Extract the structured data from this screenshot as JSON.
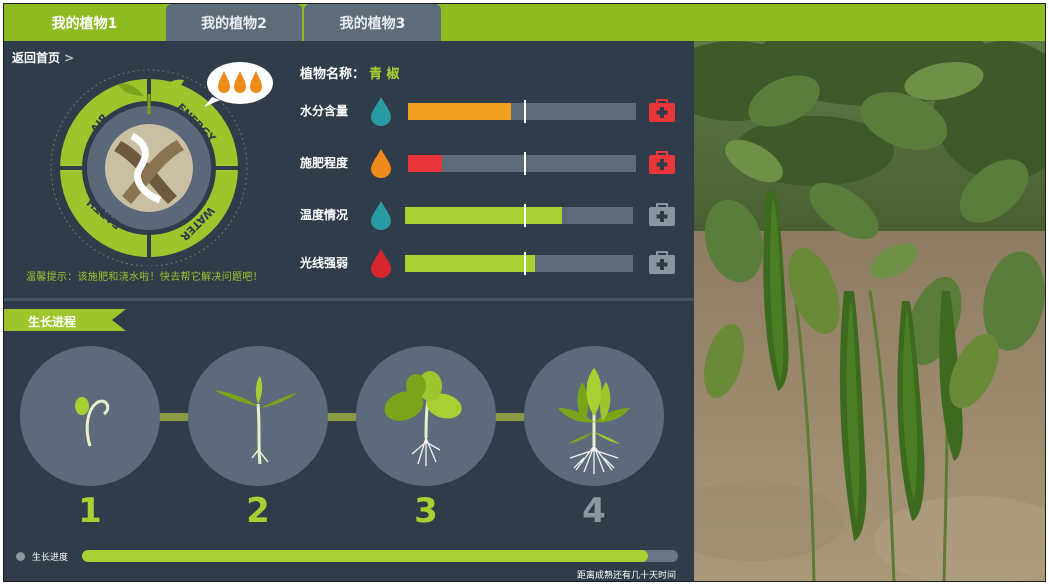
{
  "tabs": [
    {
      "label": "我的植物1",
      "active": true
    },
    {
      "label": "我的植物2",
      "active": false
    },
    {
      "label": "我的植物3",
      "active": false
    }
  ],
  "back_link": {
    "label": "返回首页",
    "chevron": ">"
  },
  "emblem": {
    "labels": [
      "AIR",
      "ENERGY",
      "EARTH",
      "WATER"
    ],
    "colors": {
      "ring": "#9fc52c",
      "inner": "#596778",
      "core": "#c9c0a4",
      "accent": "#6d5a3e"
    }
  },
  "alert_text": "温馨提示：该施肥和浇水啦！快去帮它解决问题吧！",
  "plant": {
    "name_label": "植物名称：",
    "name_value": "青 椒"
  },
  "metrics": [
    {
      "label": "水分含量",
      "drop_color": "#2a9aa3",
      "fill_color": "#f2a01f",
      "value": 0.45,
      "mark": 0.51,
      "kit_color": "#e8363b",
      "kit_active": true
    },
    {
      "label": "施肥程度",
      "drop_color": "#f08a1a",
      "fill_color": "#e8363b",
      "value": 0.15,
      "mark": 0.51,
      "kit_color": "#e8363b",
      "kit_active": true
    },
    {
      "label": "温度情况",
      "drop_color": "#2a9aa3",
      "fill_color": "#a9d033",
      "value": 0.69,
      "mark": 0.52,
      "kit_color": "#8a95a3",
      "kit_active": false
    },
    {
      "label": "光线强弱",
      "drop_color": "#d8262e",
      "fill_color": "#a9d033",
      "value": 0.57,
      "mark": 0.52,
      "kit_color": "#8a95a3",
      "kit_active": false
    }
  ],
  "growth": {
    "title": "生长进程",
    "stages": [
      {
        "number": "1",
        "name": "sprout",
        "complete": true
      },
      {
        "number": "2",
        "name": "seedling",
        "complete": true
      },
      {
        "number": "3",
        "name": "young-plant",
        "complete": true
      },
      {
        "number": "4",
        "name": "mature-plant",
        "complete": false
      }
    ],
    "colors": {
      "complete": "#a9d033",
      "incomplete": "#8c97a3"
    }
  },
  "progress": {
    "label": "生长进度",
    "value": 0.95,
    "caption": "距离成熟还有几十天时间"
  },
  "photo": {
    "subject": "green-pepper-plant"
  }
}
